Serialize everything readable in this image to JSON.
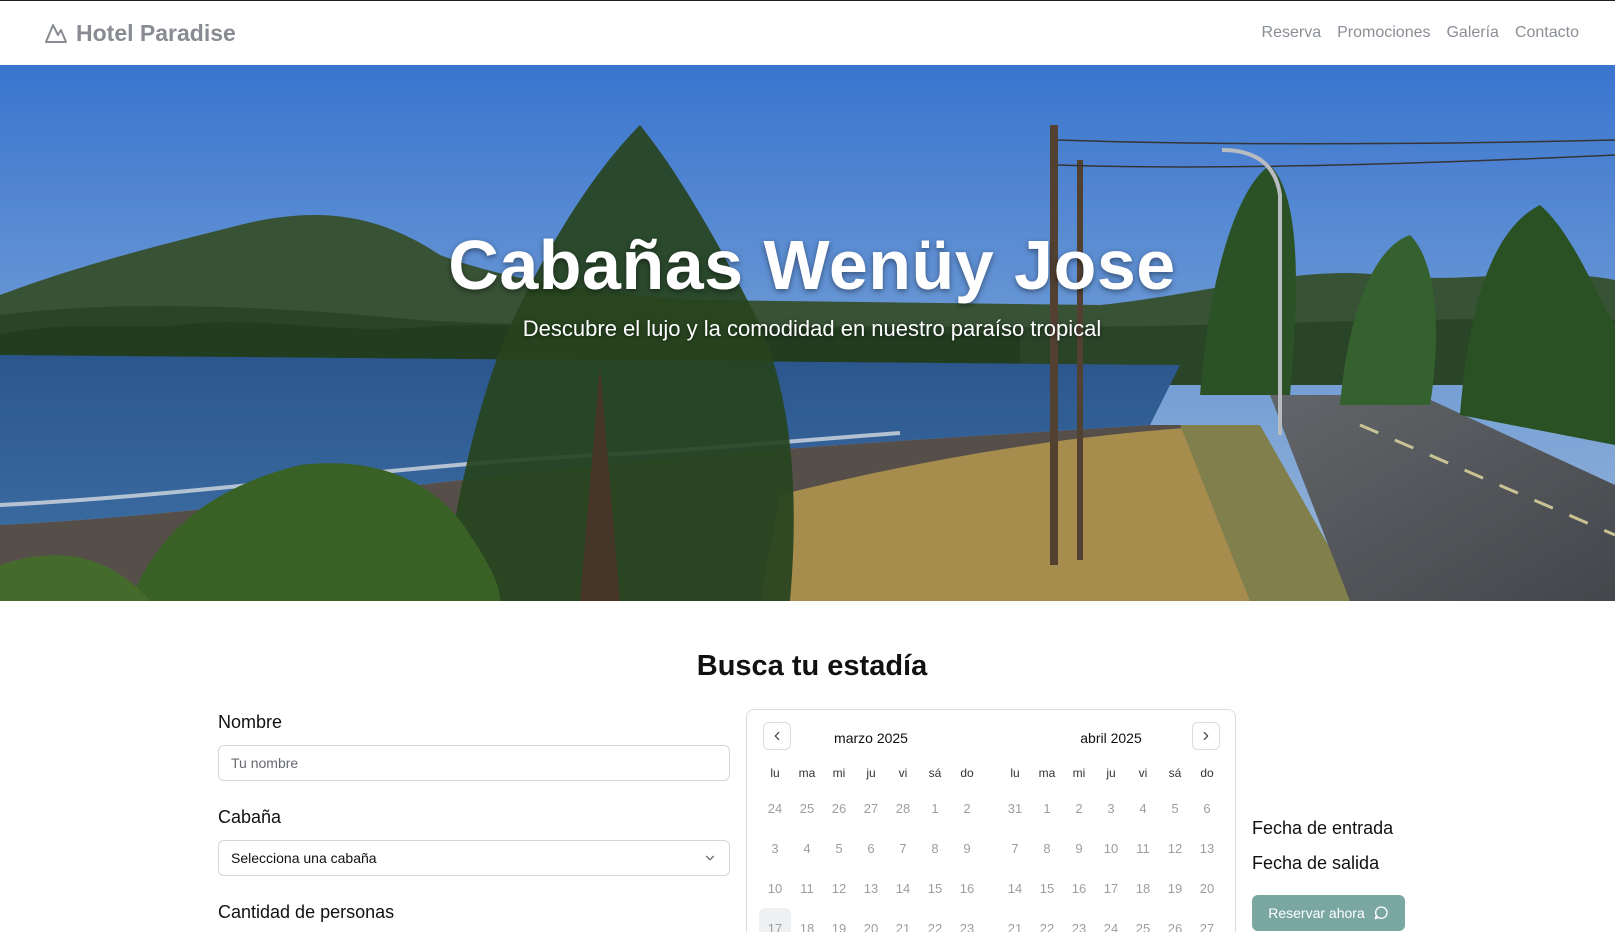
{
  "brand": {
    "name": "Hotel Paradise",
    "icon": "mountain-icon"
  },
  "nav": {
    "links": [
      {
        "label": "Reserva"
      },
      {
        "label": "Promociones"
      },
      {
        "label": "Galería"
      },
      {
        "label": "Contacto"
      }
    ]
  },
  "hero": {
    "title": "Cabañas Wenüy Jose",
    "subtitle": "Descubre el lujo y la comodidad en nuestro paraíso tropical"
  },
  "booking": {
    "section_title": "Busca tu estadía",
    "name_label": "Nombre",
    "name_placeholder": "Tu nombre",
    "cabin_label": "Cabaña",
    "cabin_selected": "Selecciona una cabaña",
    "people_label": "Cantidad de personas",
    "check_in_label": "Fecha de entrada",
    "check_out_label": "Fecha de salida",
    "reserve_button": "Reservar ahora",
    "reserve_icon": "message-circle-icon"
  },
  "calendar": {
    "weekdays": [
      "lu",
      "ma",
      "mi",
      "ju",
      "vi",
      "sá",
      "do"
    ],
    "months": [
      {
        "title": "marzo 2025",
        "days": [
          "24",
          "25",
          "26",
          "27",
          "28",
          "1",
          "2",
          "3",
          "4",
          "5",
          "6",
          "7",
          "8",
          "9",
          "10",
          "11",
          "12",
          "13",
          "14",
          "15",
          "16",
          "17",
          "18",
          "19",
          "20",
          "21",
          "22",
          "23"
        ],
        "today_index": 21
      },
      {
        "title": "abril 2025",
        "days": [
          "31",
          "1",
          "2",
          "3",
          "4",
          "5",
          "6",
          "7",
          "8",
          "9",
          "10",
          "11",
          "12",
          "13",
          "14",
          "15",
          "16",
          "17",
          "18",
          "19",
          "20",
          "21",
          "22",
          "23",
          "24",
          "25",
          "26",
          "27"
        ],
        "today_index": -1
      }
    ]
  },
  "colors": {
    "accent_button": "#7aa7a1",
    "nav_text": "#8a8f96",
    "brand_text": "#888c92"
  }
}
